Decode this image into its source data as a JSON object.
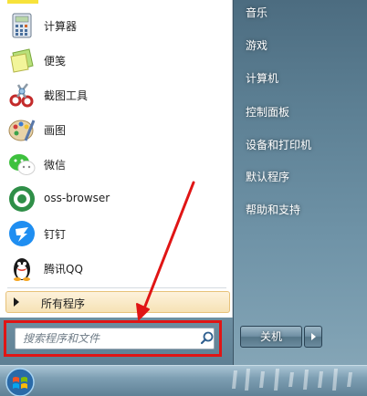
{
  "start_menu": {
    "programs": [
      {
        "label": "计算器",
        "icon": "calculator-icon"
      },
      {
        "label": "便笺",
        "icon": "sticky-notes-icon"
      },
      {
        "label": "截图工具",
        "icon": "snipping-tool-icon"
      },
      {
        "label": "画图",
        "icon": "paint-icon"
      },
      {
        "label": "微信",
        "icon": "wechat-icon"
      },
      {
        "label": "oss-browser",
        "icon": "oss-browser-icon"
      },
      {
        "label": "钉钉",
        "icon": "dingtalk-icon"
      },
      {
        "label": "腾讯QQ",
        "icon": "qq-penguin-icon"
      }
    ],
    "all_programs_label": "所有程序",
    "search": {
      "placeholder": "搜索程序和文件",
      "value": ""
    },
    "right_items": [
      "音乐",
      "游戏",
      "计算机",
      "控制面板",
      "设备和打印机",
      "默认程序",
      "帮助和支持"
    ],
    "shutdown_label": "关机"
  },
  "colors": {
    "highlight_box": "#e01515",
    "arrow": "#e01515",
    "all_programs_bg": "#f6e2b5"
  }
}
